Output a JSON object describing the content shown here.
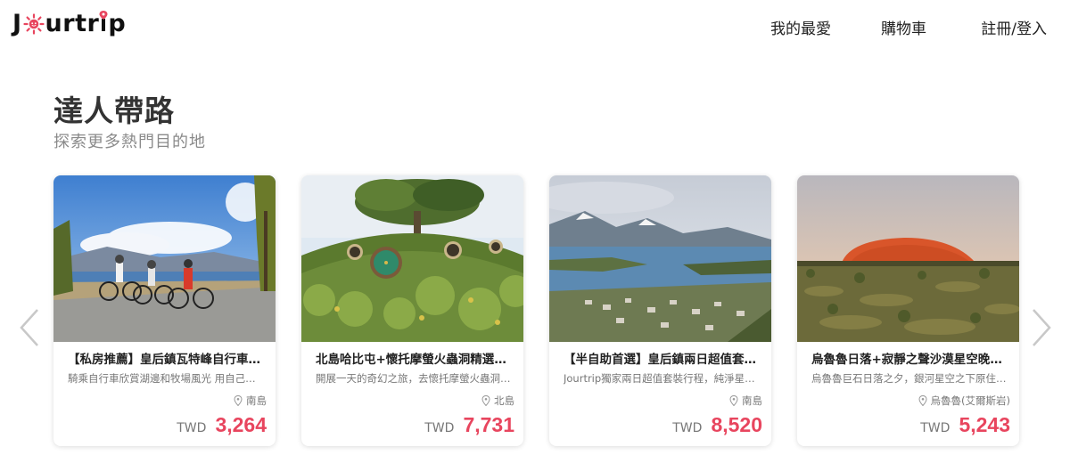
{
  "header": {
    "logo_prefix": "J",
    "logo_suffix": "urtr",
    "logo_end": "p",
    "nav": {
      "favorites": "我的最愛",
      "cart": "購物車",
      "login": "註冊/登入"
    }
  },
  "section": {
    "title": "達人帶路",
    "subtitle": "探索更多熱門目的地"
  },
  "colors": {
    "accent": "#e8455e",
    "logo_sun": "#e8455e"
  },
  "icons": {
    "prev": "chevron-left-icon",
    "next": "chevron-right-icon",
    "location": "map-pin-icon"
  },
  "cards": [
    {
      "name": "【私房推薦】皇后鎮瓦特峰自行車…",
      "desc": "騎乘自行車欣賞湖邊和牧場風光 用自己的…",
      "location": "南島",
      "currency": "TWD",
      "price": "3,264"
    },
    {
      "name": "北島哈比屯+懷托摩螢火蟲洞精選一…",
      "desc": "開展一天的奇幻之旅，去懷托摩螢火蟲洞…",
      "location": "北島",
      "currency": "TWD",
      "price": "7,731"
    },
    {
      "name": "【半自助首選】皇后鎮兩日超值套…",
      "desc": "Jourtrip獨家兩日超值套裝行程，純淨星…",
      "location": "南島",
      "currency": "TWD",
      "price": "8,520"
    },
    {
      "name": "烏魯魯日落+寂靜之聲沙漠星空晚宴…",
      "desc": "烏魯魯巨石日落之夕，銀河星空之下原住…",
      "location": "烏魯魯(艾爾斯岩)",
      "currency": "TWD",
      "price": "5,243"
    }
  ]
}
